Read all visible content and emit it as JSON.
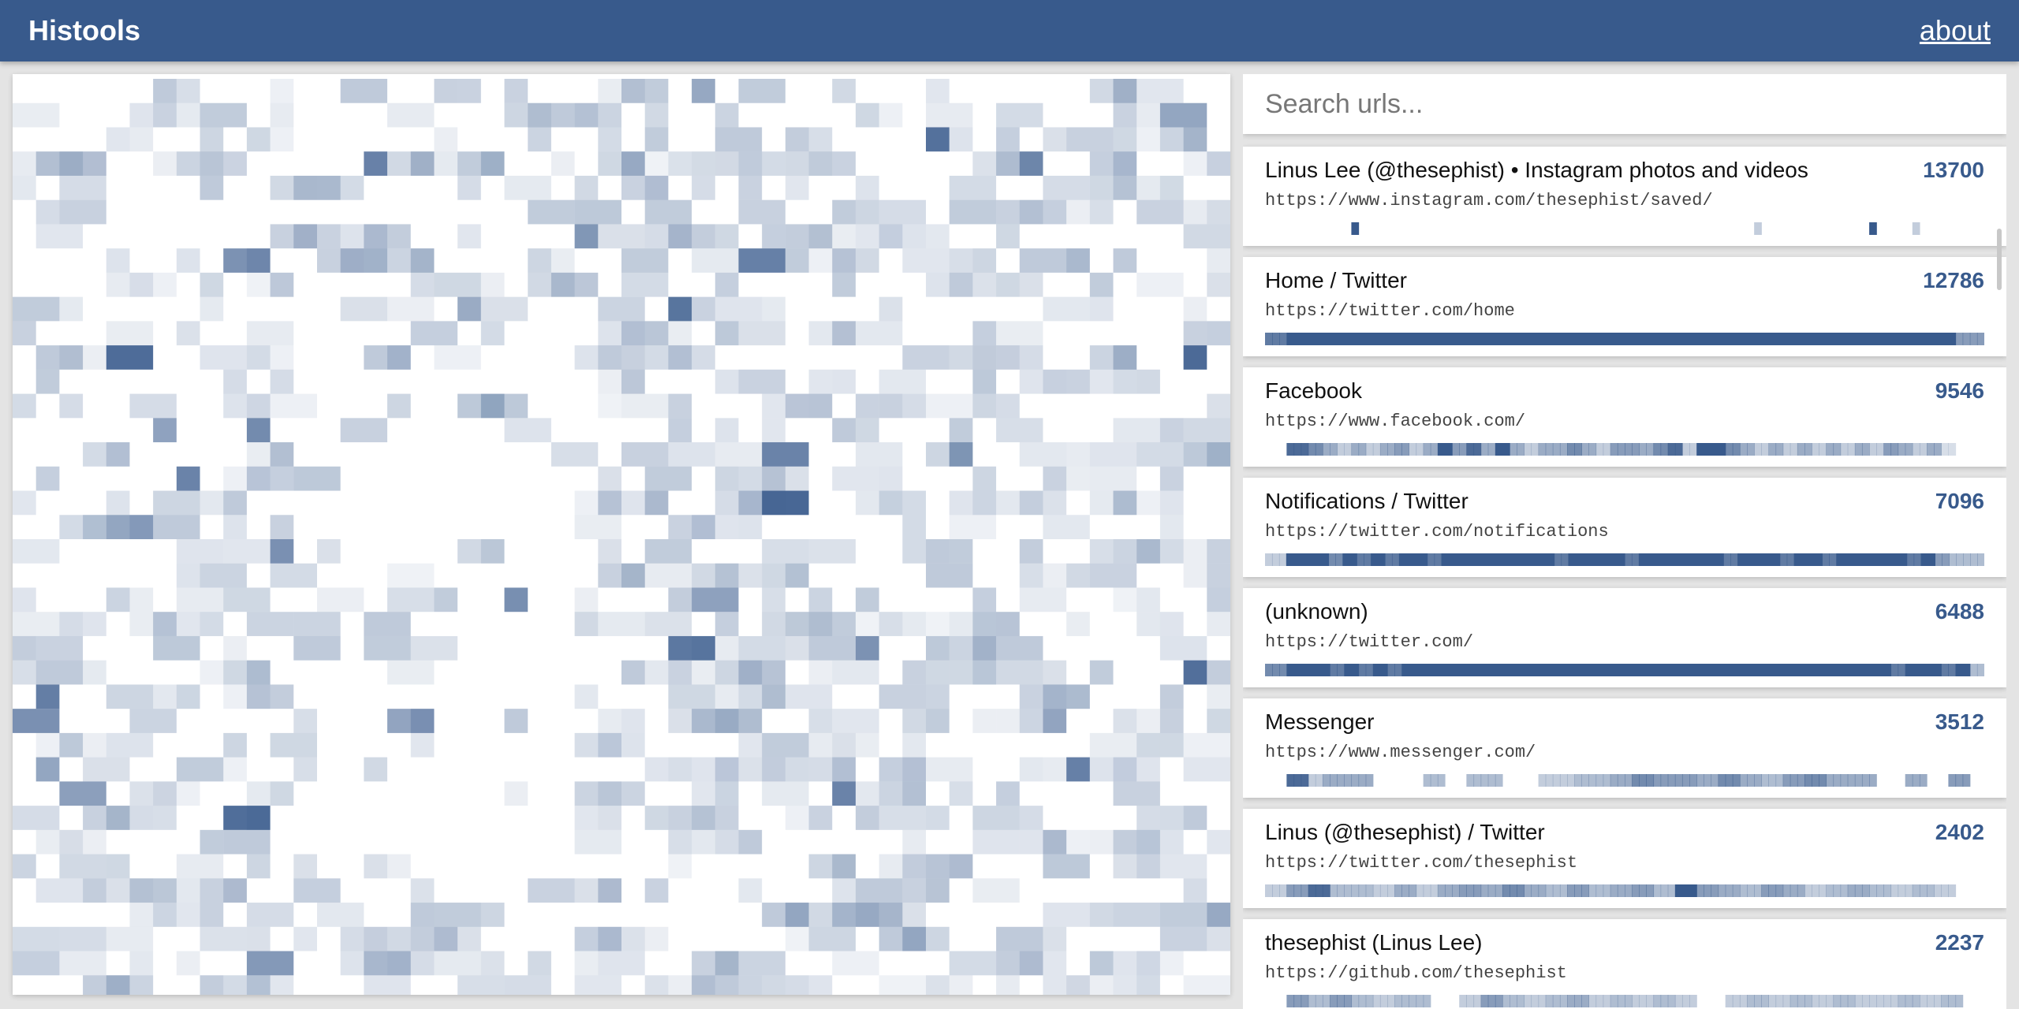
{
  "theme": {
    "brand": "#385a8c",
    "cell_rgb": "56,90,140"
  },
  "header": {
    "title": "Histools",
    "about_label": "about"
  },
  "search": {
    "placeholder": "Search urls...",
    "value": ""
  },
  "entries": [
    {
      "title": "Linus Lee (@thesephist) • Instagram photos and videos",
      "count": "13700",
      "url": "https://www.instagram.com/thesephist/saved/",
      "activity": [
        0,
        0,
        0,
        0,
        0,
        0,
        0,
        0,
        0,
        0,
        0,
        0,
        1,
        0,
        0,
        0,
        0,
        0,
        0,
        0,
        0,
        0,
        0,
        0,
        0,
        0,
        0,
        0,
        0,
        0,
        0,
        0,
        0,
        0,
        0,
        0,
        0,
        0,
        0,
        0,
        0,
        0,
        0,
        0,
        0,
        0,
        0,
        0,
        0,
        0,
        0,
        0,
        0,
        0,
        0,
        0,
        0,
        0,
        0,
        0,
        0,
        0,
        0,
        0,
        0,
        0,
        0,
        0,
        0.3,
        0,
        0,
        0,
        0,
        0,
        0,
        0,
        0,
        0,
        0,
        0,
        0,
        0,
        0,
        0,
        1,
        0,
        0,
        0,
        0,
        0,
        0.3,
        0,
        0,
        0,
        0,
        0,
        0,
        0,
        0,
        0
      ]
    },
    {
      "title": "Home / Twitter",
      "count": "12786",
      "url": "https://twitter.com/home",
      "activity": [
        0.8,
        0.8,
        0.8,
        1,
        1,
        1,
        1,
        1,
        1,
        1,
        1,
        1,
        1,
        1,
        1,
        1,
        1,
        1,
        1,
        1,
        1,
        1,
        1,
        1,
        1,
        1,
        1,
        1,
        1,
        1,
        1,
        1,
        1,
        1,
        1,
        1,
        1,
        1,
        1,
        1,
        1,
        1,
        1,
        1,
        1,
        1,
        1,
        1,
        1,
        1,
        1,
        1,
        1,
        1,
        1,
        1,
        1,
        1,
        1,
        1,
        1,
        1,
        1,
        1,
        1,
        1,
        1,
        1,
        1,
        1,
        1,
        1,
        1,
        1,
        1,
        1,
        1,
        1,
        1,
        1,
        1,
        1,
        1,
        1,
        1,
        1,
        1,
        1,
        1,
        1,
        1,
        1,
        1,
        1,
        1,
        1,
        0.6,
        0.6,
        0.6,
        0.6
      ]
    },
    {
      "title": "Facebook",
      "count": "9546",
      "url": "https://www.facebook.com/",
      "activity": [
        0,
        0,
        0,
        0.9,
        0.9,
        0.9,
        0.7,
        0.7,
        0.5,
        0.5,
        0.3,
        0.3,
        0.5,
        0.5,
        0.3,
        0.3,
        0.5,
        0.5,
        0.6,
        0.6,
        0.3,
        0.3,
        0.5,
        0.5,
        1,
        1,
        0.6,
        0.6,
        0.9,
        0.9,
        0.5,
        0.5,
        1,
        1,
        0.5,
        0.5,
        0.3,
        0.3,
        0.5,
        0.5,
        0.5,
        0.5,
        0.7,
        0.7,
        0.5,
        0.5,
        0.3,
        0.3,
        0.6,
        0.6,
        0.6,
        0.6,
        0.5,
        0.5,
        0.7,
        0.7,
        0.9,
        0.9,
        0.3,
        0.3,
        1,
        1,
        1,
        1,
        0.7,
        0.7,
        0.5,
        0.5,
        0.3,
        0.3,
        0.5,
        0.5,
        0.3,
        0.3,
        0.5,
        0.5,
        0.3,
        0.3,
        0.5,
        0.5,
        0.3,
        0.3,
        0.5,
        0.5,
        0.3,
        0.3,
        0.6,
        0.6,
        0.5,
        0.5,
        0.3,
        0.3,
        0.5,
        0.5,
        0.2,
        0.2,
        0,
        0,
        0,
        0
      ]
    },
    {
      "title": "Notifications / Twitter",
      "count": "7096",
      "url": "https://twitter.com/notifications",
      "activity": [
        0.3,
        0.3,
        0.3,
        1,
        1,
        1,
        1,
        1,
        1,
        0.7,
        0.7,
        1,
        1,
        0.8,
        0.8,
        1,
        1,
        0.8,
        0.8,
        1,
        1,
        1,
        1,
        0.8,
        0.8,
        1,
        1,
        1,
        1,
        1,
        1,
        1,
        1,
        1,
        1,
        1,
        1,
        1,
        1,
        1,
        1,
        0.8,
        0.8,
        1,
        1,
        1,
        1,
        1,
        1,
        1,
        1,
        0.8,
        0.8,
        1,
        1,
        1,
        1,
        1,
        1,
        1,
        1,
        1,
        1,
        1,
        1,
        0.8,
        0.8,
        1,
        1,
        1,
        1,
        1,
        1,
        0.8,
        0.8,
        1,
        1,
        1,
        1,
        0.8,
        0.8,
        1,
        1,
        1,
        1,
        1,
        1,
        1,
        1,
        1,
        1,
        0.8,
        0.8,
        1,
        1,
        0.6,
        0.6,
        0.4,
        0.4,
        0.4,
        0.4,
        0.4
      ]
    },
    {
      "title": "(unknown)",
      "count": "6488",
      "url": "https://twitter.com/",
      "activity": [
        0.7,
        0.7,
        0.7,
        1,
        1,
        1,
        1,
        1,
        1,
        0.8,
        0.8,
        1,
        1,
        0.8,
        0.8,
        1,
        1,
        0.8,
        0.8,
        1,
        1,
        1,
        1,
        1,
        1,
        1,
        1,
        1,
        1,
        1,
        1,
        1,
        1,
        1,
        1,
        1,
        1,
        1,
        1,
        1,
        1,
        1,
        1,
        1,
        1,
        1,
        1,
        1,
        1,
        1,
        1,
        1,
        1,
        1,
        1,
        1,
        1,
        1,
        1,
        1,
        1,
        1,
        1,
        1,
        1,
        1,
        1,
        1,
        1,
        1,
        1,
        1,
        1,
        1,
        1,
        1,
        1,
        1,
        1,
        1,
        1,
        1,
        1,
        1,
        1,
        1,
        1,
        0.8,
        0.8,
        1,
        1,
        1,
        1,
        1,
        0.8,
        0.8,
        1,
        1,
        0.4,
        0.4
      ]
    },
    {
      "title": "Messenger",
      "count": "3512",
      "url": "https://www.messenger.com/",
      "activity": [
        0,
        0,
        0,
        0.9,
        0.9,
        0.9,
        0.3,
        0.3,
        0.5,
        0.5,
        0.5,
        0.5,
        0.5,
        0.5,
        0.5,
        0,
        0,
        0,
        0,
        0,
        0,
        0,
        0.4,
        0.4,
        0.4,
        0,
        0,
        0,
        0.4,
        0.4,
        0.4,
        0.4,
        0.4,
        0,
        0,
        0,
        0,
        0,
        0.3,
        0.3,
        0.3,
        0.3,
        0.3,
        0.4,
        0.4,
        0.4,
        0.4,
        0.4,
        0.5,
        0.5,
        0.5,
        0.7,
        0.7,
        0.7,
        0.6,
        0.6,
        0.6,
        0.6,
        0.6,
        0.6,
        0.5,
        0.5,
        0.5,
        0.7,
        0.7,
        0.7,
        0.5,
        0.5,
        0.5,
        0.4,
        0.4,
        0.4,
        0.6,
        0.6,
        0.6,
        0.7,
        0.7,
        0.7,
        0.5,
        0.5,
        0.5,
        0.5,
        0.5,
        0.5,
        0.5,
        0,
        0,
        0,
        0,
        0.5,
        0.5,
        0.5,
        0,
        0,
        0,
        0.6,
        0.6,
        0.6,
        0,
        0
      ]
    },
    {
      "title": "Linus (@thesephist) / Twitter",
      "count": "2402",
      "url": "https://twitter.com/thesephist",
      "activity": [
        0.3,
        0.3,
        0.3,
        0.6,
        0.6,
        0.6,
        0.9,
        0.9,
        0.9,
        0.4,
        0.4,
        0.4,
        0.4,
        0.4,
        0.4,
        0.3,
        0.3,
        0.3,
        0.5,
        0.5,
        0.5,
        0.3,
        0.3,
        0.3,
        0.5,
        0.5,
        0.5,
        0.6,
        0.6,
        0.6,
        0.5,
        0.5,
        0.5,
        0.7,
        0.7,
        0.7,
        0.5,
        0.5,
        0.5,
        0.4,
        0.4,
        0.4,
        0.6,
        0.6,
        0.6,
        0.4,
        0.4,
        0.4,
        0.5,
        0.5,
        0.5,
        0.6,
        0.6,
        0.6,
        0.4,
        0.4,
        0.4,
        1,
        1,
        1,
        0.6,
        0.6,
        0.6,
        0.5,
        0.5,
        0.5,
        0.4,
        0.4,
        0.4,
        0.6,
        0.6,
        0.6,
        0.5,
        0.5,
        0.5,
        0.3,
        0.3,
        0.3,
        0.4,
        0.4,
        0.4,
        0.5,
        0.5,
        0.5,
        0.4,
        0.4,
        0.4,
        0.3,
        0.3,
        0.3,
        0.4,
        0.4,
        0.4,
        0.3,
        0.3,
        0.3,
        0,
        0,
        0,
        0
      ]
    },
    {
      "title": "thesephist (Linus Lee)",
      "count": "2237",
      "url": "https://github.com/thesephist",
      "activity": [
        0,
        0,
        0,
        0.6,
        0.6,
        0.6,
        0.4,
        0.4,
        0.4,
        0.6,
        0.6,
        0.6,
        0.4,
        0.4,
        0.4,
        0.3,
        0.3,
        0.3,
        0.4,
        0.4,
        0.4,
        0.4,
        0.4,
        0,
        0,
        0,
        0,
        0.3,
        0.3,
        0.3,
        0.6,
        0.6,
        0.6,
        0.4,
        0.4,
        0.4,
        0.3,
        0.3,
        0.3,
        0.4,
        0.4,
        0.4,
        0.5,
        0.5,
        0.5,
        0.3,
        0.3,
        0.3,
        0.4,
        0.4,
        0.4,
        0.3,
        0.3,
        0.3,
        0.4,
        0.4,
        0.4,
        0.3,
        0.3,
        0.3,
        0,
        0,
        0,
        0,
        0.3,
        0.3,
        0.3,
        0.4,
        0.4,
        0.4,
        0.3,
        0.3,
        0.3,
        0.4,
        0.4,
        0.4,
        0.3,
        0.3,
        0.3,
        0.4,
        0.4,
        0.4,
        0.3,
        0.3,
        0.3,
        0.3,
        0.3,
        0.3,
        0.4,
        0.4,
        0.4,
        0.3,
        0.3,
        0.3,
        0.4,
        0.4,
        0.4,
        0,
        0,
        0
      ]
    }
  ]
}
